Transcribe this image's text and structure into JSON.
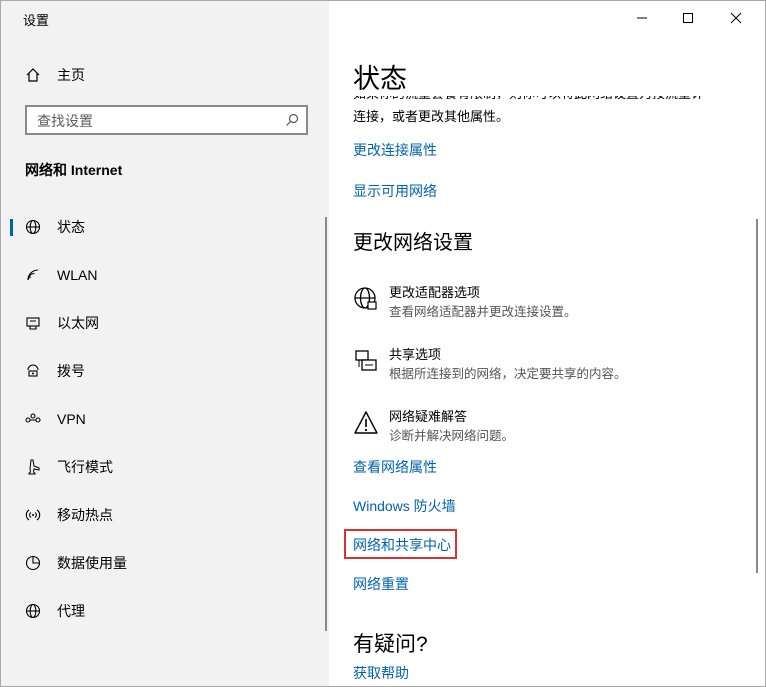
{
  "window": {
    "title": "设置",
    "controls": {
      "minimize": "—",
      "maximize": "☐",
      "close": "✕"
    }
  },
  "sidebar": {
    "home_label": "主页",
    "search_placeholder": "查找设置",
    "section_title": "网络和 Internet",
    "items": [
      {
        "label": "状态",
        "icon": "globe-icon",
        "active": true
      },
      {
        "label": "WLAN",
        "icon": "wifi-icon",
        "active": false
      },
      {
        "label": "以太网",
        "icon": "ethernet-icon",
        "active": false
      },
      {
        "label": "拨号",
        "icon": "dialup-icon",
        "active": false
      },
      {
        "label": "VPN",
        "icon": "vpn-icon",
        "active": false
      },
      {
        "label": "飞行模式",
        "icon": "airplane-icon",
        "active": false
      },
      {
        "label": "移动热点",
        "icon": "hotspot-icon",
        "active": false
      },
      {
        "label": "数据使用量",
        "icon": "data-usage-icon",
        "active": false
      },
      {
        "label": "代理",
        "icon": "proxy-globe-icon",
        "active": false
      }
    ]
  },
  "main": {
    "title": "状态",
    "clipped_text": "如果你的流量套餐有限制，则你可以将此网络设置为按流量计",
    "body_text": "连接，或者更改其他属性。",
    "links_top": [
      "更改连接属性",
      "显示可用网络"
    ],
    "change_settings_heading": "更改网络设置",
    "options": [
      {
        "title": "更改适配器选项",
        "desc": "查看网络适配器并更改连接设置。",
        "icon": "adapter-globe-icon"
      },
      {
        "title": "共享选项",
        "desc": "根据所连接到的网络，决定要共享的内容。",
        "icon": "sharing-icon"
      },
      {
        "title": "网络疑难解答",
        "desc": "诊断并解决网络问题。",
        "icon": "warning-icon"
      }
    ],
    "links_bottom": [
      "查看网络属性",
      "Windows 防火墙",
      "网络和共享中心",
      "网络重置"
    ],
    "question_heading": "有疑问?",
    "help_link": "获取帮助"
  },
  "colors": {
    "accent": "#0063b1",
    "sidebar_bg": "#f2f2f2",
    "highlight": "#d9322f"
  }
}
